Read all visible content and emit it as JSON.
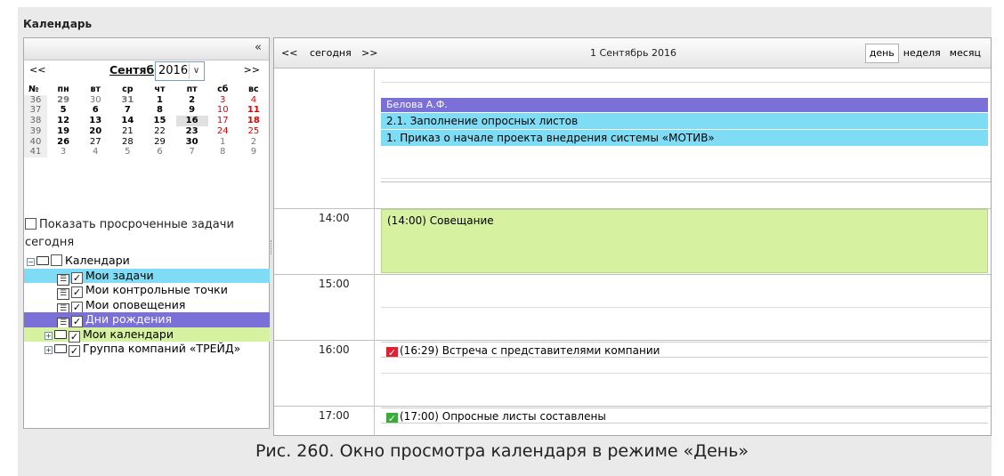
{
  "app": {
    "title": "Календарь"
  },
  "left_panel": {
    "collapse_label": "«",
    "mini_calendar": {
      "prev": "<<",
      "next": ">>",
      "month": "Сентябрь",
      "year": "2016",
      "week_header": "№",
      "weekdays": [
        "пн",
        "вт",
        "ср",
        "чт",
        "пт",
        "сб",
        "вс"
      ],
      "weeks": [
        {
          "wk": "36",
          "days": [
            "29",
            "30",
            "31",
            "1",
            "2",
            "3",
            "4"
          ]
        },
        {
          "wk": "37",
          "days": [
            "5",
            "6",
            "7",
            "8",
            "9",
            "10",
            "11"
          ]
        },
        {
          "wk": "38",
          "days": [
            "12",
            "13",
            "14",
            "15",
            "16",
            "17",
            "18"
          ]
        },
        {
          "wk": "39",
          "days": [
            "19",
            "20",
            "21",
            "22",
            "23",
            "24",
            "25"
          ]
        },
        {
          "wk": "40",
          "days": [
            "26",
            "27",
            "28",
            "29",
            "30",
            "1",
            "2"
          ]
        },
        {
          "wk": "41",
          "days": [
            "3",
            "4",
            "5",
            "6",
            "7",
            "8",
            "9"
          ]
        }
      ]
    },
    "show_overdue_label": "Показать просроченные задачи сегодня",
    "tree": {
      "root": "Календари",
      "items": [
        {
          "label": "Мои задачи"
        },
        {
          "label": "Мои контрольные точки"
        },
        {
          "label": "Мои оповещения"
        },
        {
          "label": "Дни рождения"
        },
        {
          "label": "Мои календари"
        },
        {
          "label": "Группа компаний «ТРЕЙД»"
        }
      ]
    }
  },
  "toolbar": {
    "prev": "<<",
    "today": "сегодня",
    "next": ">>",
    "current_date": "1 Сентябрь 2016",
    "views": [
      "день",
      "неделя",
      "месяц"
    ],
    "active_view": "день"
  },
  "day_view": {
    "allday_events": [
      "Белова А.Ф.",
      "2.1. Заполнение опросных листов",
      "1. Приказ о начале проекта внедрения системы «МОТИВ»"
    ],
    "hours": [
      "14:00",
      "15:00",
      "16:00",
      "17:00"
    ],
    "events": [
      {
        "text": "(14:00) Совещание"
      },
      {
        "text": "(16:29) Встреча с представителями компании",
        "mark": "✓"
      },
      {
        "text": "(17:00) Опросные листы составлены",
        "mark": "✓"
      }
    ],
    "colors": {
      "purple": "#7a70d8",
      "cyan": "#7fdcf5",
      "lime": "#d6f2a0",
      "red": "#e02030",
      "green": "#3aaa3a"
    }
  },
  "caption": "Рис. 260. Окно просмотра календаря в режиме «День»"
}
